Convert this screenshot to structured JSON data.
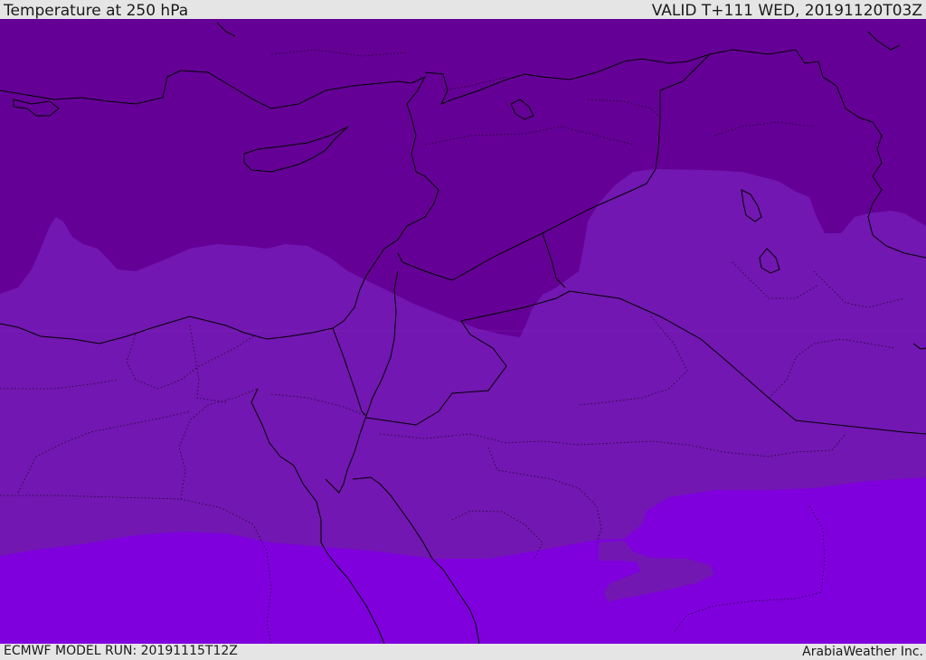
{
  "header": {
    "title": "Temperature at 250 hPa",
    "valid_time": "VALID T+111 WED, 20191120T03Z"
  },
  "footer": {
    "model_run": "ECMWF MODEL RUN: 20191115T12Z",
    "credit": "ArabiaWeather Inc."
  },
  "colors": {
    "cold_band": "#650096",
    "mid_band": "#7217b1",
    "warm_band": "#7f00dd",
    "border": "#000000"
  }
}
